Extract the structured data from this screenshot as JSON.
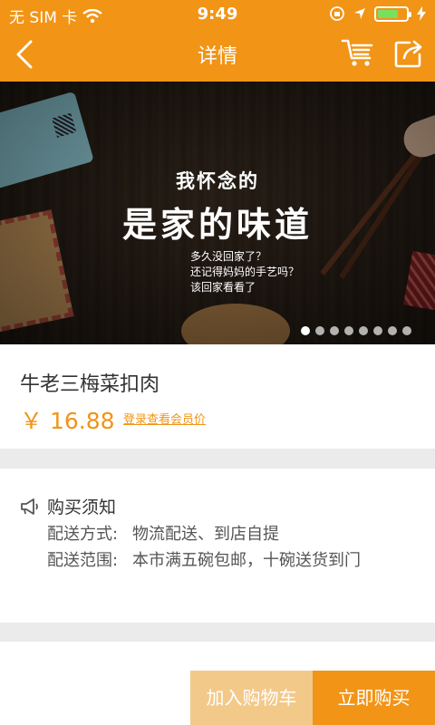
{
  "status_bar": {
    "carrier": "无 SIM 卡",
    "time": "9:49"
  },
  "nav": {
    "title": "详情",
    "icons": [
      "back-icon",
      "cart-icon",
      "share-icon"
    ]
  },
  "banner": {
    "line1": "我怀念的",
    "line2": "是家的味道",
    "sub": [
      "多久没回家了？",
      "还记得妈妈的手艺吗？",
      "该回家看看了"
    ],
    "page_count": 8,
    "active_page": 1
  },
  "product": {
    "name": "牛老三梅菜扣肉",
    "price": "￥ 16.88",
    "member_link": "登录查看会员价"
  },
  "notice": {
    "title": "购买须知",
    "rows": [
      {
        "label": "配送方式:",
        "value": "物流配送、到店自提"
      },
      {
        "label": "配送范围:",
        "value": "本市满五碗包邮，十碗送货到门"
      }
    ]
  },
  "actions": {
    "add_to_cart": "加入购物车",
    "buy_now": "立即购买"
  },
  "colors": {
    "accent": "#f29416",
    "accent_light": "#f3c98a",
    "battery_green": "#77e05c"
  }
}
